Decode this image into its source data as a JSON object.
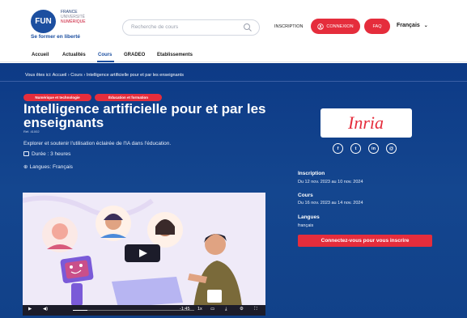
{
  "brand": {
    "logo_text": "FUN",
    "line1": "FRANCE",
    "line2": "UNIVERSITÉ",
    "line3": "NUMÉRIQUE",
    "tagline": "Se former en liberté",
    "accent_color": "#e52d3c",
    "primary_color": "#1c4fa0"
  },
  "header": {
    "search_placeholder": "Recherche de cours",
    "search_icon": "search-icon",
    "inscription": "INSCRIPTION",
    "connexion": "CONNEXION",
    "faq": "FAQ",
    "language": "Français",
    "language_icon": "chevron-down-icon"
  },
  "nav": {
    "items": [
      "Accueil",
      "Actualités",
      "Cours",
      "GRADEO",
      "Etablissements"
    ],
    "active": "Cours"
  },
  "breadcrumb": "Vous êtes ici:  Accueil › Cours › Intelligence artificielle pour et par les enseignants",
  "course": {
    "tags": [
      "Numérique et technologie",
      "Éducation et formation"
    ],
    "title": "Intelligence artificielle pour et par les enseignants",
    "ref": "Réf. 41002",
    "description": "Explorer et soutenir l'utilisation éclairée de l'IA dans l'éducation.",
    "duration": "Durée : 3 heures",
    "duration_icon": "calendar-icon",
    "languages": "Langues: Français",
    "languages_icon": "globe-icon"
  },
  "video": {
    "time": "-1:45",
    "speed": "1x",
    "progress": 0.12
  },
  "sidebar": {
    "partner_logo": "Inria",
    "social": [
      "f",
      "t",
      "in",
      "@"
    ],
    "inscription_label": "Inscription",
    "inscription_value": "Du 12 nov. 2023 au 10 nov. 2024",
    "cours_label": "Cours",
    "cours_value": "Du 16 nov. 2023 au 14 nov. 2024",
    "langues_label": "Langues",
    "langues_value": "français",
    "cta": "Connectez-vous pour vous inscrire"
  }
}
